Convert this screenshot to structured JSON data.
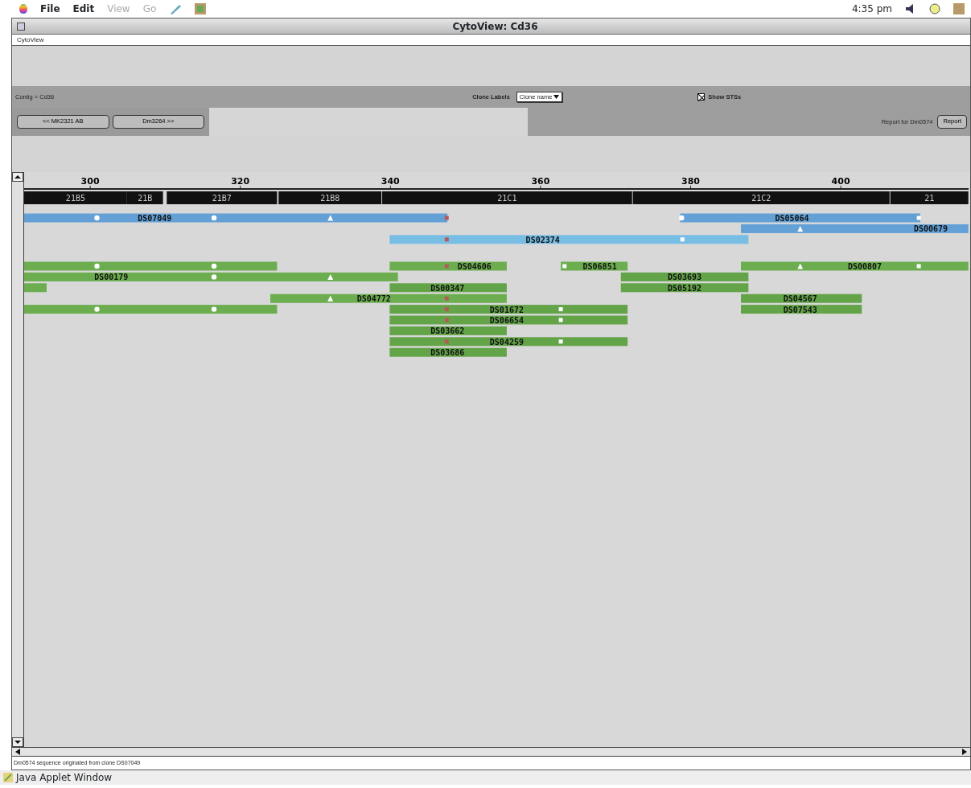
{
  "menu_bar": {
    "items": [
      {
        "label": "File",
        "disabled": false
      },
      {
        "label": "Edit",
        "disabled": false
      },
      {
        "label": "View",
        "disabled": true
      },
      {
        "label": "Go",
        "disabled": true
      }
    ],
    "time": "4:35 pm"
  },
  "window": {
    "title": "CytoView: Cd36",
    "menu": "CytoView"
  },
  "controls": {
    "contig": "Contig = Cd36",
    "clone_labels": {
      "label": "Clone Labels",
      "value": "Clone name"
    },
    "show_sts": {
      "label": "Show STSs",
      "checked": true
    }
  },
  "nav_buttons": [
    "<< MK2321 AB",
    "Dm3264 >>"
  ],
  "report": {
    "label": "Report for Dm0574",
    "button": "Report"
  },
  "map": {
    "ticks": [
      "300",
      "320",
      "340",
      "360",
      "380",
      "400"
    ],
    "bands": [
      "21B5",
      "21B",
      "21B7",
      "21B8",
      "21C1",
      "21C2",
      "21"
    ],
    "blue_lanes": [
      {
        "clones": [
          {
            "name": "DS07049",
            "color": "#62a0d6",
            "markers": [
              {
                "kind": "circle"
              },
              {
                "kind": "circle"
              },
              {
                "kind": "triangle"
              },
              {
                "kind": "probe"
              }
            ]
          },
          {
            "name": "DS05064",
            "color": "#62a0d6",
            "markers": [
              {
                "kind": "circle"
              },
              {
                "kind": "square"
              }
            ]
          }
        ]
      },
      {
        "clones": [
          {
            "name": "DS00679",
            "color": "#62a0d6",
            "markers": [
              {
                "kind": "triangle"
              }
            ]
          }
        ]
      },
      {
        "clones": [
          {
            "name": "DS02374",
            "color": "#78bde4",
            "markers": [
              {
                "kind": "probe"
              },
              {
                "kind": "square"
              }
            ]
          }
        ]
      }
    ],
    "green_lanes": [
      {
        "clones": [
          {
            "color": "#6cae4f",
            "markers": [
              {
                "kind": "circle"
              },
              {
                "kind": "circle"
              }
            ]
          },
          {
            "name": "DS04606",
            "color": "#6cae4f",
            "markers": [
              {
                "kind": "probe"
              }
            ]
          },
          {
            "name": "DS06851",
            "color": "#6cae4f",
            "markers": [
              {
                "kind": "square"
              }
            ]
          },
          {
            "name": "DS00807",
            "color": "#6cae4f",
            "markers": [
              {
                "kind": "triangle"
              },
              {
                "kind": "square"
              }
            ]
          }
        ]
      },
      {
        "clones": [
          {
            "name": "DS00179",
            "color": "#6cae4f",
            "markers": [
              {
                "kind": "circle"
              },
              {
                "kind": "triangle"
              }
            ]
          },
          {
            "name": "DS03693",
            "color": "#63a449"
          }
        ]
      },
      {
        "clones": [
          {
            "color": "#6cae4f"
          },
          {
            "name": "DS00347",
            "color": "#63a449"
          },
          {
            "name": "DS05192",
            "color": "#63a449"
          }
        ]
      },
      {
        "clones": [
          {
            "name": "DS04772",
            "color": "#6cae4f",
            "markers": [
              {
                "kind": "triangle"
              },
              {
                "kind": "probe"
              }
            ]
          },
          {
            "name": "DS04567",
            "color": "#63a449"
          }
        ]
      },
      {
        "clones": [
          {
            "color": "#6cae4f",
            "markers": [
              {
                "kind": "circle"
              },
              {
                "kind": "circle"
              }
            ]
          },
          {
            "name": "DS01672",
            "color": "#63a449",
            "markers": [
              {
                "kind": "probe"
              },
              {
                "kind": "square"
              }
            ]
          },
          {
            "name": "DS07543",
            "color": "#63a449"
          }
        ]
      },
      {
        "clones": [
          {
            "name": "DS06654",
            "color": "#63a449",
            "markers": [
              {
                "kind": "probe"
              },
              {
                "kind": "square"
              }
            ]
          }
        ]
      },
      {
        "clones": [
          {
            "name": "DS03662",
            "color": "#63a449"
          }
        ]
      },
      {
        "clones": [
          {
            "name": "DS04259",
            "color": "#63a449",
            "markers": [
              {
                "kind": "probe"
              },
              {
                "kind": "square"
              }
            ]
          }
        ]
      },
      {
        "clones": [
          {
            "name": "DS03686",
            "color": "#63a449"
          }
        ]
      }
    ]
  },
  "status": "Dm0574 sequence originated from clone DS07049",
  "applet_bar": "Java Applet Window"
}
